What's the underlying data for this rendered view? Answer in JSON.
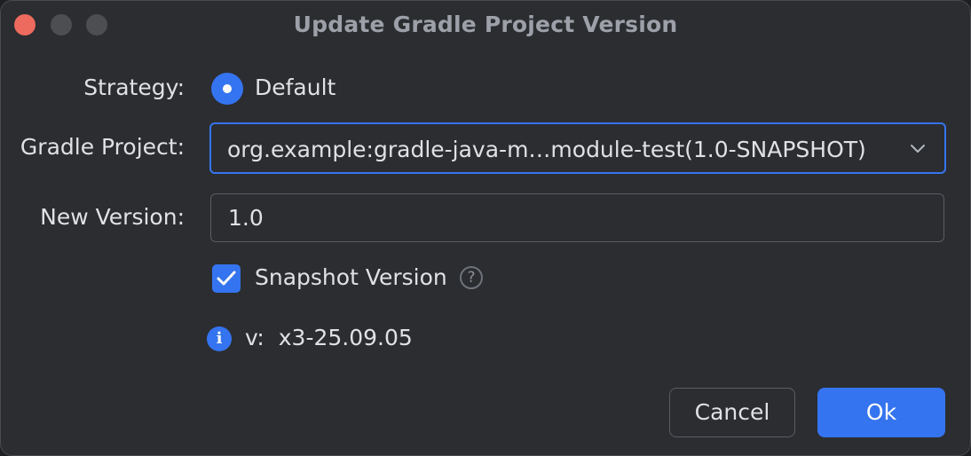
{
  "window": {
    "title": "Update Gradle Project Version",
    "controls": [
      "close",
      "minimize",
      "maximize"
    ]
  },
  "form": {
    "strategy": {
      "label": "Strategy:",
      "option_label": "Default",
      "selected": true
    },
    "gradle_project": {
      "label": "Gradle Project:",
      "value": "org.example:gradle-java-m…module-test(1.0-SNAPSHOT)"
    },
    "new_version": {
      "label": "New Version:",
      "value": "1.0"
    },
    "snapshot": {
      "label": "Snapshot Version",
      "checked": true,
      "help_glyph": "?"
    },
    "info": {
      "icon_glyph": "i",
      "text": "v:  x3-25.09.05"
    }
  },
  "buttons": {
    "cancel": "Cancel",
    "ok": "Ok"
  },
  "colors": {
    "accent": "#3574f0",
    "background": "#2b2d30",
    "close_button": "#ed6a5e"
  }
}
